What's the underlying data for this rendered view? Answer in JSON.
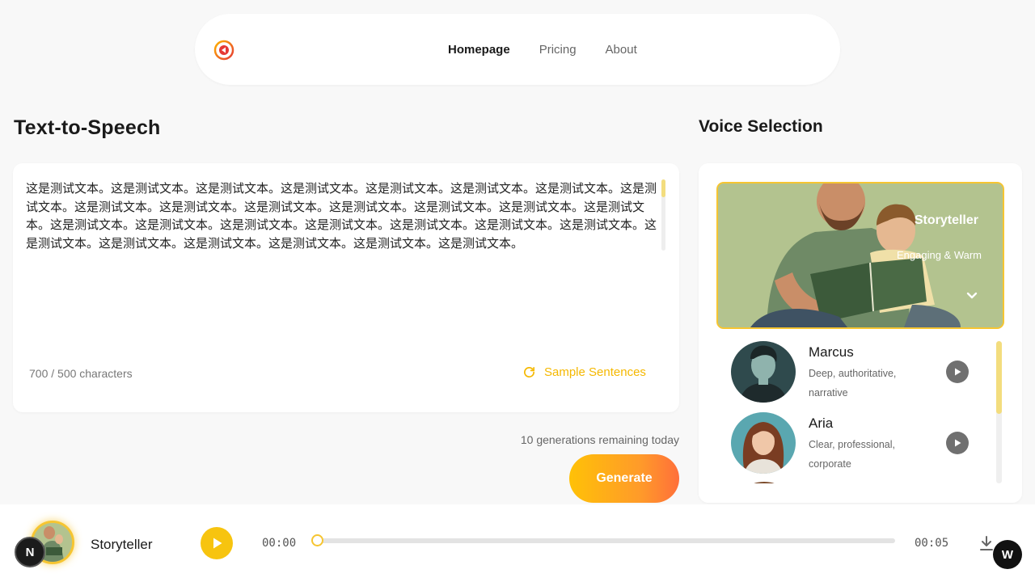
{
  "nav": {
    "logo": "brand-logo",
    "links": [
      {
        "label": "Homepage",
        "active": true
      },
      {
        "label": "Pricing",
        "active": false
      },
      {
        "label": "About",
        "active": false
      }
    ]
  },
  "tts": {
    "title": "Text-to-Speech",
    "text": "这是测试文本。这是测试文本。这是测试文本。这是测试文本。这是测试文本。这是测试文本。这是测试文本。这是测试文本。这是测试文本。这是测试文本。这是测试文本。这是测试文本。这是测试文本。这是测试文本。这是测试文本。这是测试文本。这是测试文本。这是测试文本。这是测试文本。这是测试文本。这是测试文本。这是测试文本。这是测试文本。这是测试文本。这是测试文本。这是测试文本。这是测试文本。这是测试文本。",
    "char_count": "700 / 500 characters",
    "sample_label": "Sample Sentences",
    "remaining": "10 generations remaining today",
    "generate_label": "Generate"
  },
  "voice": {
    "title": "Voice Selection",
    "featured": {
      "name": "Storyteller",
      "desc": "Engaging & Warm"
    },
    "list": [
      {
        "name": "Marcus",
        "desc": "Deep, authoritative, narrative"
      },
      {
        "name": "Aria",
        "desc": "Clear, professional, corporate"
      }
    ]
  },
  "player": {
    "voice_name": "Storyteller",
    "current_time": "00:00",
    "duration": "00:05",
    "progress": 0,
    "n_badge": "N",
    "w_badge": "W"
  },
  "colors": {
    "accent": "#f7c40f",
    "gradient_start": "#ffc107",
    "gradient_end": "#ff6f3a"
  }
}
